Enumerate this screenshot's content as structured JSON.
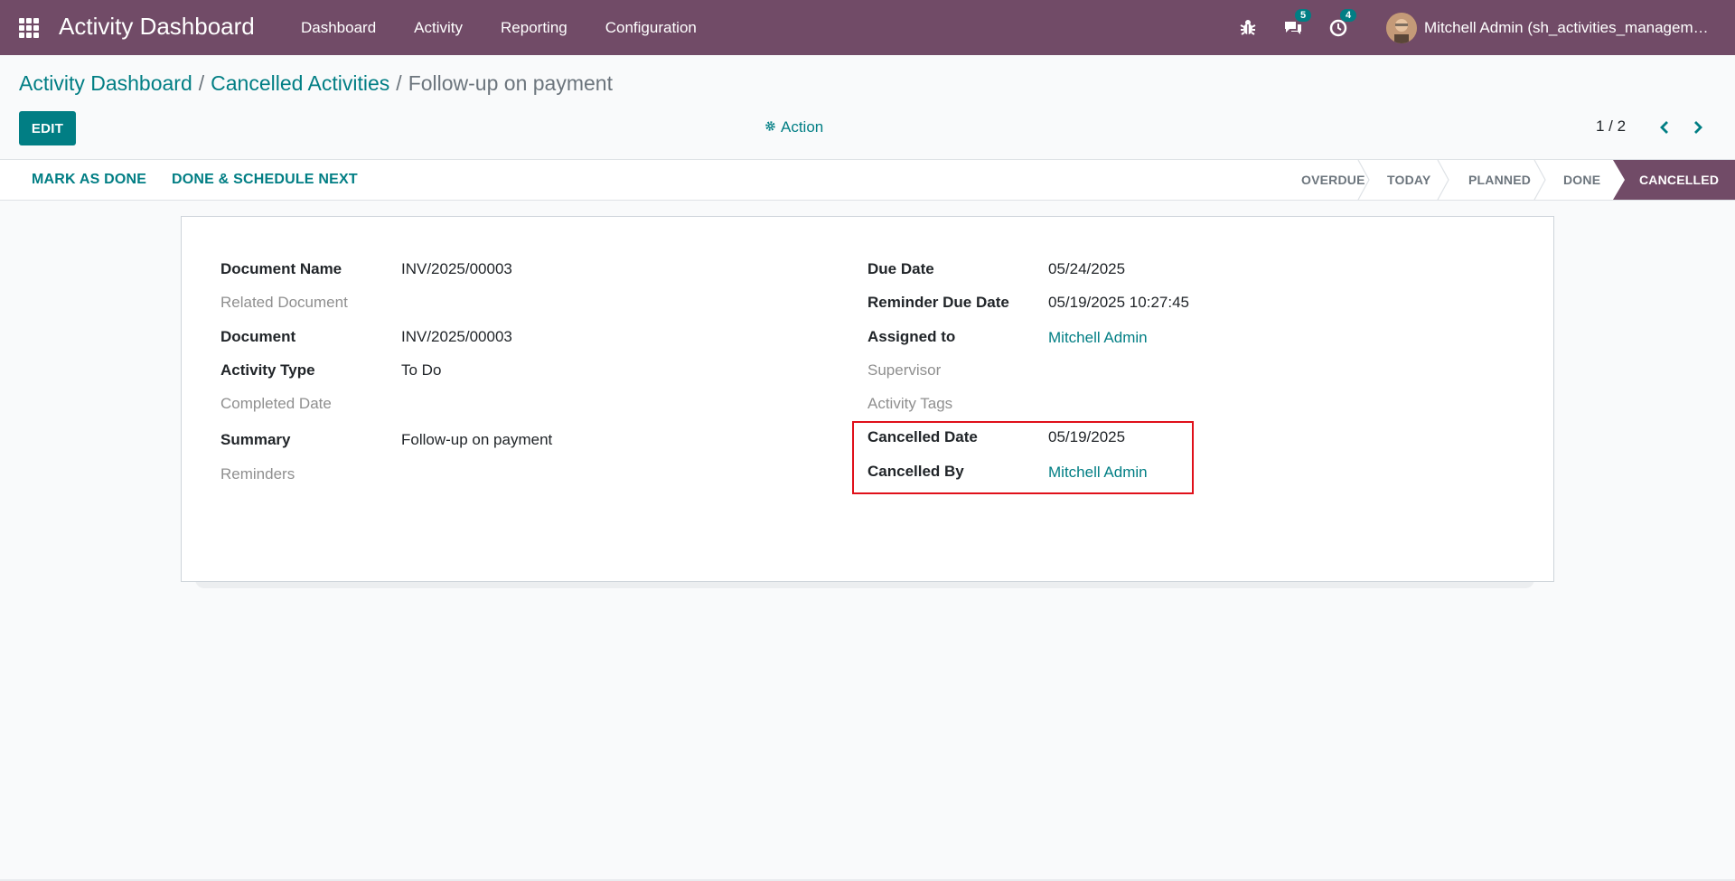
{
  "navbar": {
    "app_title": "Activity Dashboard",
    "menu": [
      "Dashboard",
      "Activity",
      "Reporting",
      "Configuration"
    ],
    "messages_count": "5",
    "activities_count": "4",
    "user_name": "Mitchell Admin (sh_activities_management_db)",
    "color": "#714b67"
  },
  "breadcrumb": {
    "root": "Activity Dashboard",
    "parent": "Cancelled Activities",
    "current": "Follow-up on payment",
    "separator": "/"
  },
  "control": {
    "edit_label": "EDIT",
    "action_label": "Action",
    "pager": "1 / 2"
  },
  "statusbar": {
    "mark_done": "MARK AS DONE",
    "done_schedule": "DONE & SCHEDULE NEXT",
    "stages": [
      "OVERDUE",
      "TODAY",
      "PLANNED",
      "DONE",
      "CANCELLED"
    ],
    "active_stage": "CANCELLED"
  },
  "form": {
    "left": {
      "document_name": {
        "label": "Document Name",
        "value": "INV/2025/00003"
      },
      "related_document": {
        "label": "Related Document",
        "value": ""
      },
      "document": {
        "label": "Document",
        "value": "INV/2025/00003"
      },
      "activity_type": {
        "label": "Activity Type",
        "value": "To Do"
      },
      "completed_date": {
        "label": "Completed Date",
        "value": ""
      },
      "summary": {
        "label": "Summary",
        "value": "Follow-up on payment"
      },
      "reminders": {
        "label": "Reminders",
        "value": ""
      }
    },
    "right": {
      "due_date": {
        "label": "Due Date",
        "value": "05/24/2025"
      },
      "reminder_due_date": {
        "label": "Reminder Due Date",
        "value": "05/19/2025 10:27:45"
      },
      "assigned_to": {
        "label": "Assigned to",
        "value": "Mitchell Admin"
      },
      "supervisor": {
        "label": "Supervisor",
        "value": ""
      },
      "activity_tags": {
        "label": "Activity Tags",
        "value": ""
      },
      "cancelled_date": {
        "label": "Cancelled Date",
        "value": "05/19/2025"
      },
      "cancelled_by": {
        "label": "Cancelled By",
        "value": "Mitchell Admin"
      }
    }
  },
  "colors": {
    "accent": "#017e84",
    "brand": "#714b67",
    "highlight": "#e0101a"
  },
  "icons": [
    "apps-icon",
    "bug-icon",
    "chat-icon",
    "clock-icon",
    "gear-icon",
    "chevron-left-icon",
    "chevron-right-icon"
  ]
}
